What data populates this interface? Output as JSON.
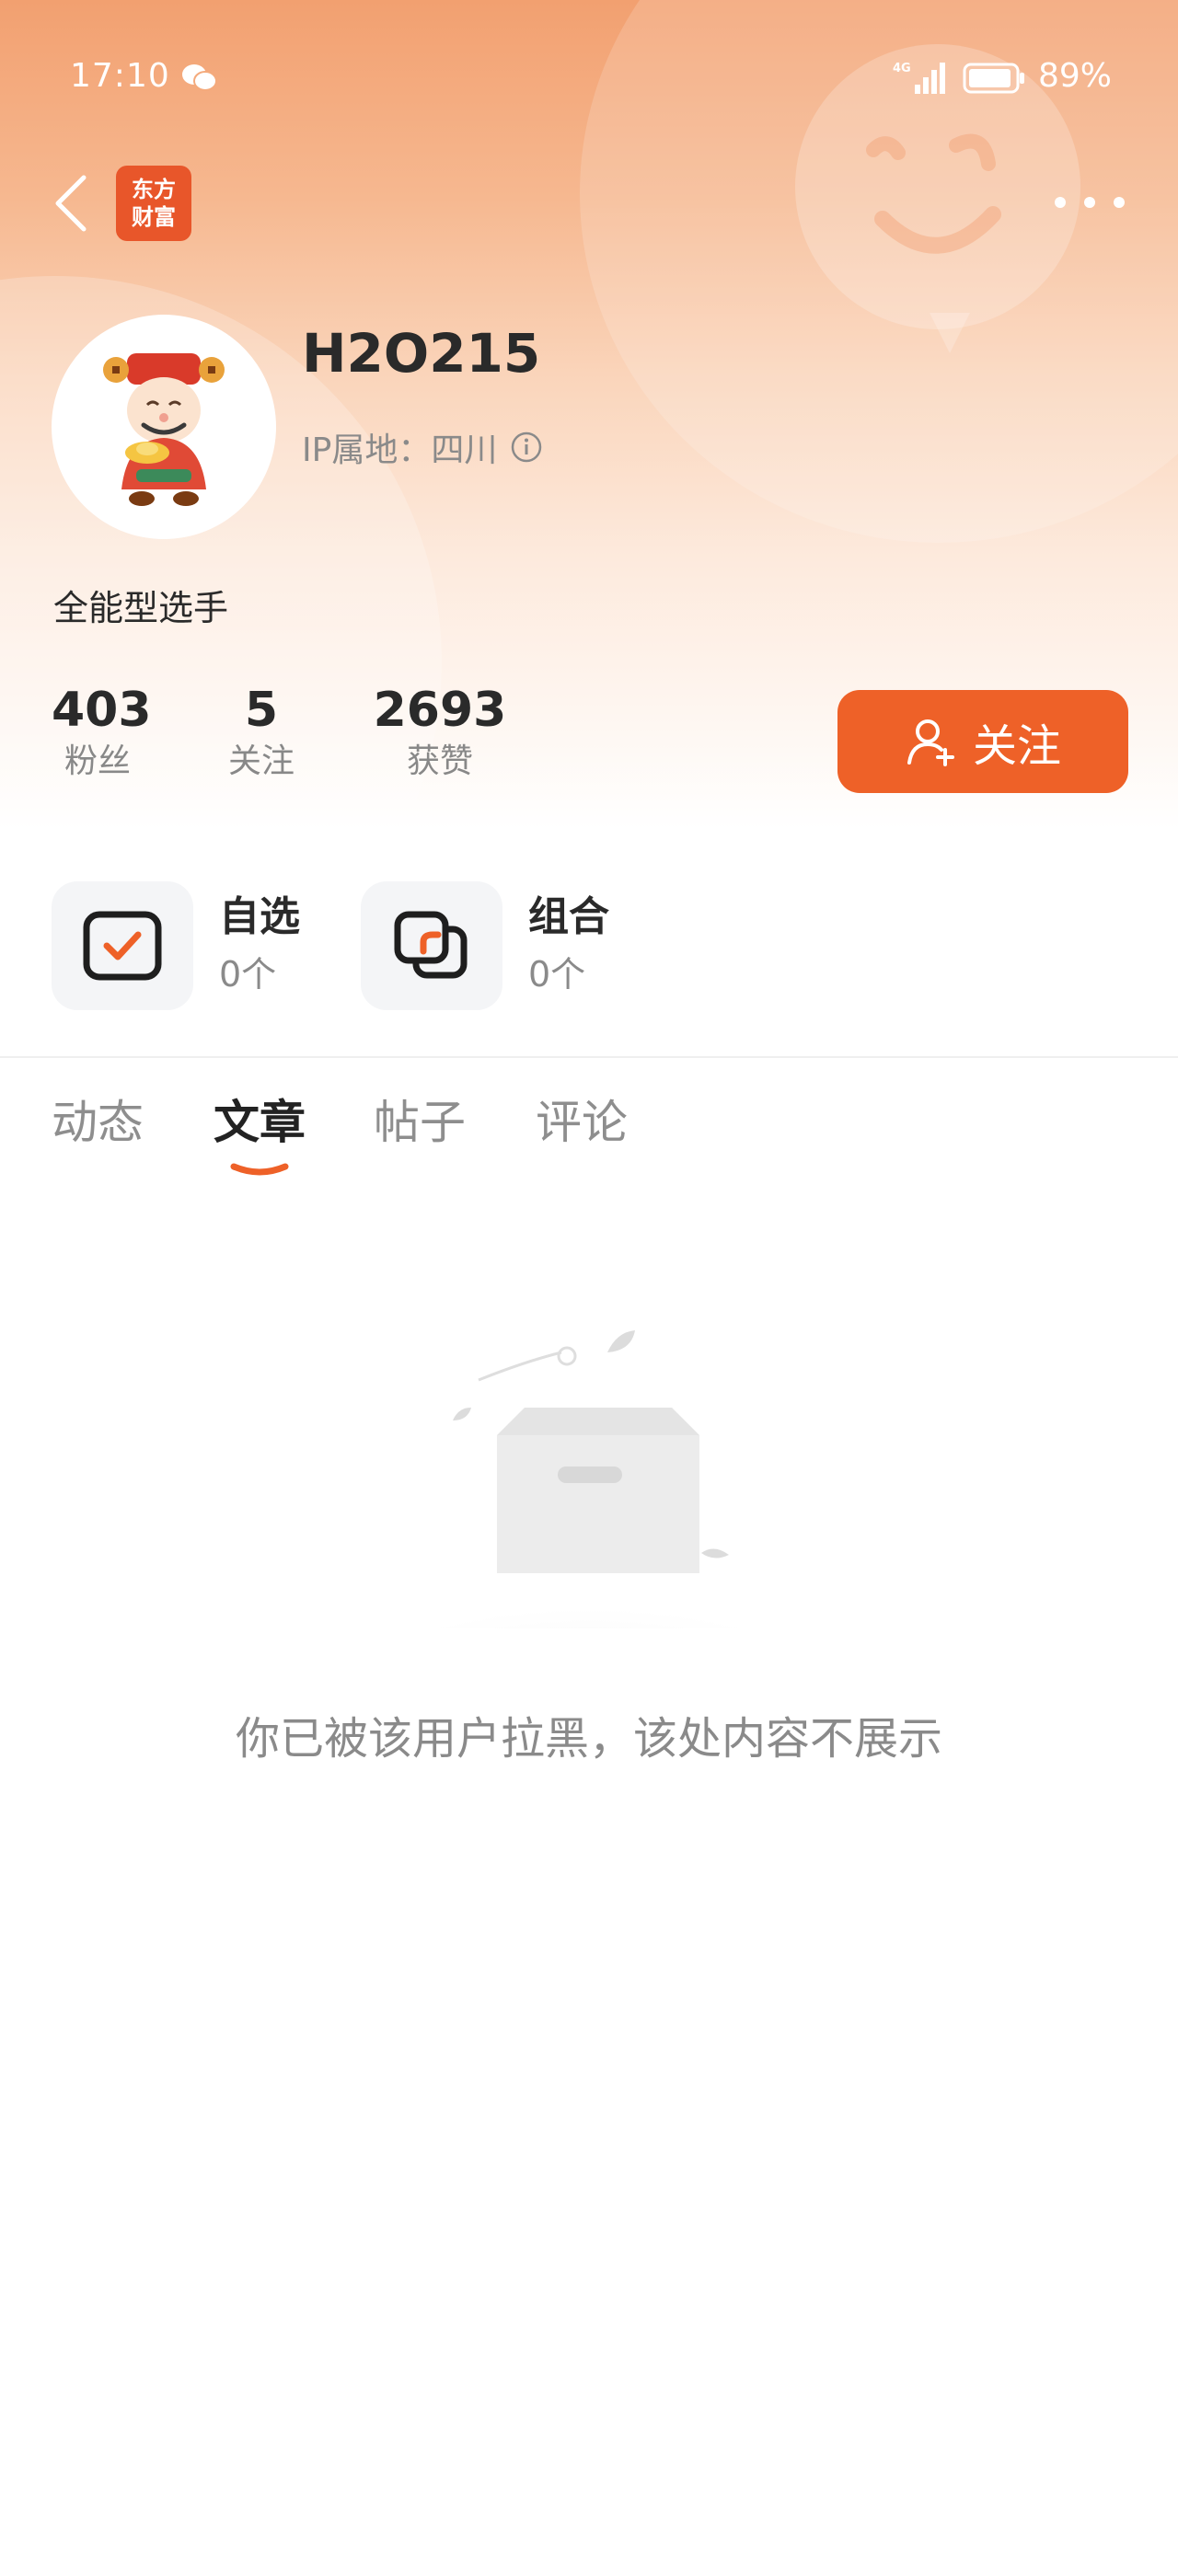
{
  "status_bar": {
    "time": "17:10",
    "network": "4G",
    "battery": "89%"
  },
  "header": {
    "app_logo_line1": "东方",
    "app_logo_line2": "财富"
  },
  "profile": {
    "username": "H2O215",
    "ip_location": "IP属地：四川",
    "bio": "全能型选手",
    "stats": [
      {
        "value": "403",
        "label": "粉丝"
      },
      {
        "value": "5",
        "label": "关注"
      },
      {
        "value": "2693",
        "label": "获赞"
      }
    ],
    "follow_button": "关注"
  },
  "quick_links": [
    {
      "title": "自选",
      "count": "0个"
    },
    {
      "title": "组合",
      "count": "0个"
    }
  ],
  "tabs": [
    {
      "label": "动态",
      "active": false
    },
    {
      "label": "文章",
      "active": true
    },
    {
      "label": "帖子",
      "active": false
    },
    {
      "label": "评论",
      "active": false
    }
  ],
  "empty_state": {
    "message": "你已被该用户拉黑，该处内容不展示"
  },
  "colors": {
    "accent": "#ee6128",
    "hero_top": "#f2a070",
    "muted_text": "#8a8a8a"
  }
}
